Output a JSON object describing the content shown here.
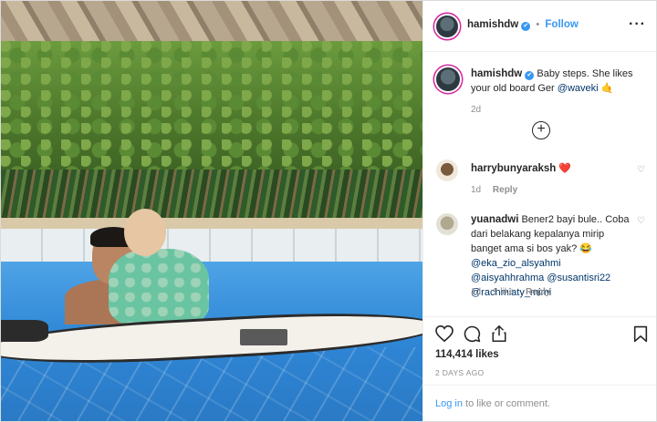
{
  "post": {
    "username": "hamishdw",
    "verified_mark": "✔",
    "follow_label": "Follow",
    "more_icon": "ellipsis-icon"
  },
  "caption": {
    "username": "hamishdw",
    "text": "Baby steps. She likes your old board Ger ",
    "mention": "@waveki",
    "emoji": "🤙",
    "age": "2d"
  },
  "comments": [
    {
      "username": "harrybunyaraksh",
      "text": "❤️",
      "age": "1d",
      "reply_label": "Reply"
    },
    {
      "username": "yuanadwi",
      "text": "Bener2 bayi bule.. Coba dari belakang kepalanya mirip banget ama si bos yak? 😂",
      "mentions": "@eka_zio_alsyahmi @aisyahhrahma @susantisri22 @rachmiaty_mimi",
      "age": "1d",
      "likes_label": "1 like",
      "reply_label": "Reply"
    }
  ],
  "stats": {
    "likes": "114,414 likes",
    "posted": "2 DAYS AGO"
  },
  "footer": {
    "login_label": "Log in",
    "rest": " to like or comment."
  },
  "icons": {
    "like": "heart-icon",
    "comment": "comment-icon",
    "share": "share-icon",
    "save": "bookmark-icon",
    "load_more": "plus-circle-icon"
  }
}
